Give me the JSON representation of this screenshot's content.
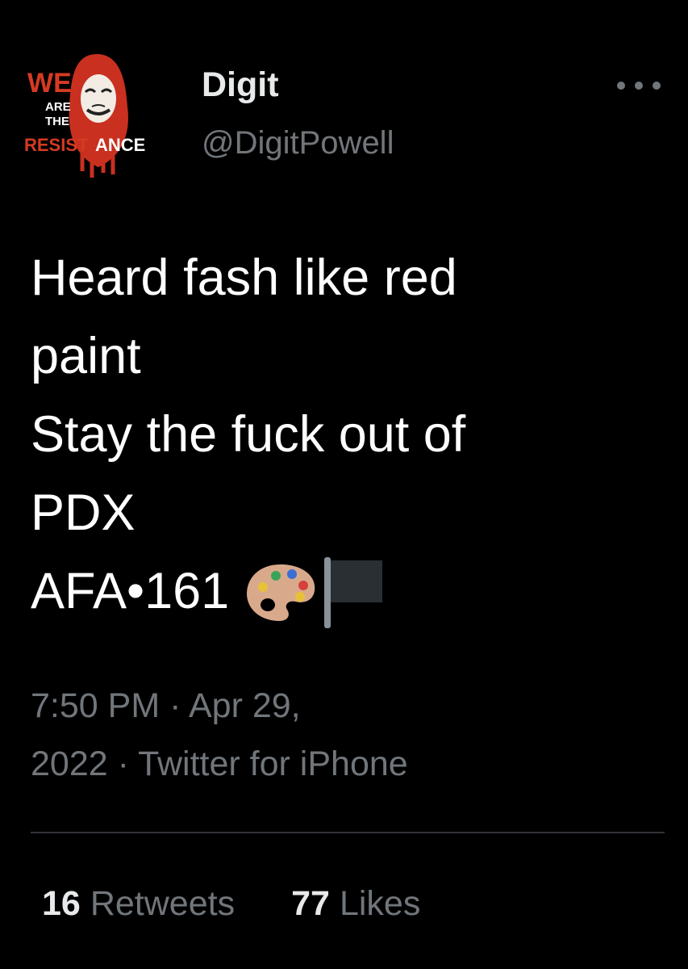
{
  "tweet": {
    "author": {
      "display_name": "Digit",
      "handle": "@DigitPowell",
      "avatar": {
        "text_we": "WE",
        "text_are": "ARE",
        "text_the": "THE",
        "text_resist": "RESIST",
        "text_ance": "ANCE",
        "accent_color": "#d63a22"
      }
    },
    "more_icon": "more-horizontal-icon",
    "text_lines": [
      "Heard fash like red",
      "paint",
      "Stay the fuck out of",
      "PDX",
      "AFA•161"
    ],
    "emojis": [
      "artist-palette-emoji",
      "black-flag-emoji"
    ],
    "timestamp_time": "7:50 PM",
    "timestamp_sep1": " · ",
    "timestamp_date_part1": "Apr 29,",
    "timestamp_date_part2": "2022",
    "timestamp_sep2": " · ",
    "source": "Twitter for iPhone",
    "retweets_count": "16",
    "retweets_label": "Retweets",
    "likes_count": "77",
    "likes_label": "Likes"
  },
  "colors": {
    "background": "#000000",
    "primary_text": "#e7e9ea",
    "secondary_text": "#71767b",
    "divider": "#2f3336"
  }
}
